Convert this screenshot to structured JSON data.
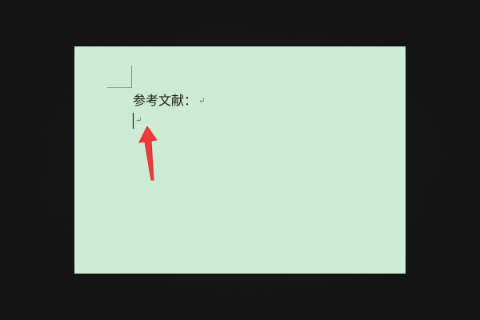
{
  "document": {
    "lines": [
      {
        "text": "参考文献：",
        "para_mark": "↵"
      },
      {
        "text": "",
        "para_mark": "↵"
      }
    ]
  },
  "colors": {
    "page_background": "#cdebd2",
    "outer_background": "#141414",
    "arrow": "#f03a3a"
  },
  "icons": {
    "annotation": "red-arrow-icon",
    "paragraph": "paragraph-mark-icon"
  }
}
